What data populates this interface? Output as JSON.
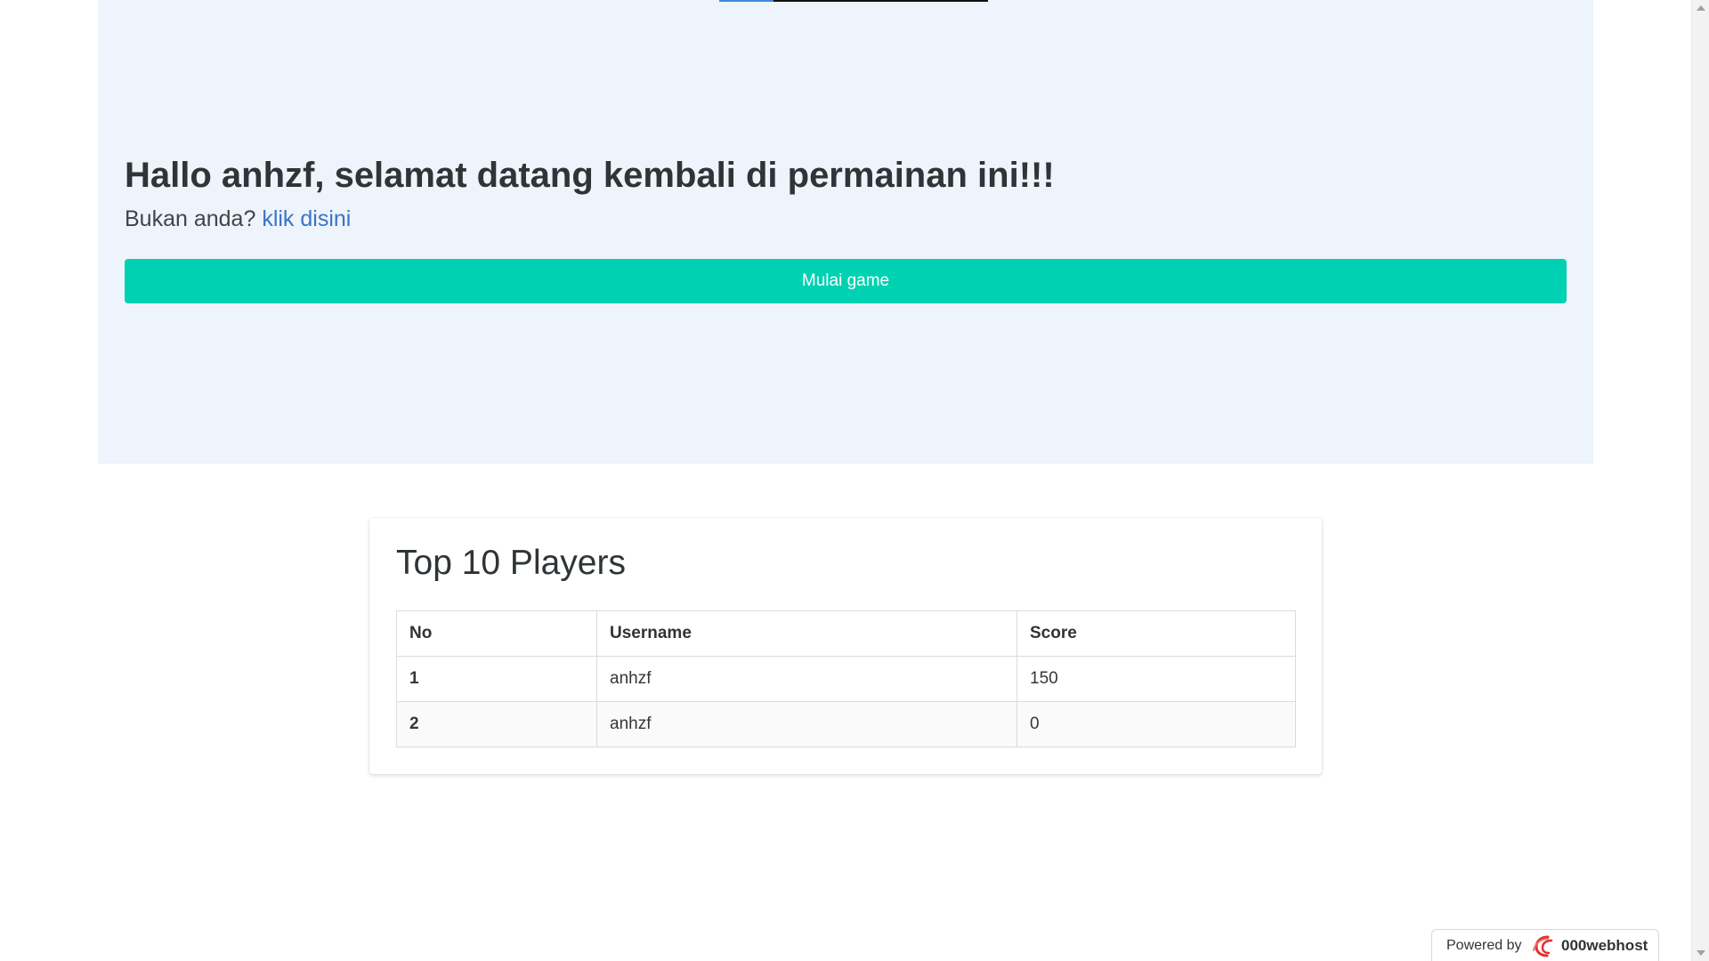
{
  "hero": {
    "title": "Hallo anhzf, selamat datang kembali di permainan ini!!!",
    "prompt": "Bukan anda?",
    "link_text": "klik disini",
    "start_button_label": "Mulai game"
  },
  "leaderboard": {
    "title": "Top 10 Players",
    "headers": {
      "no": "No",
      "username": "Username",
      "score": "Score"
    },
    "rows": [
      {
        "no": "1",
        "username": "anhzf",
        "score": "150"
      },
      {
        "no": "2",
        "username": "anhzf",
        "score": "0"
      }
    ]
  },
  "footer_badge": {
    "prefix": "Powered by",
    "brand": "000webhost",
    "icon": "000webhost-logo-icon"
  },
  "colors": {
    "hero_background": "#edf4fb",
    "primary_button": "#00d1b2",
    "link": "#3b73c9",
    "brand_logo": "#e52d2d"
  }
}
